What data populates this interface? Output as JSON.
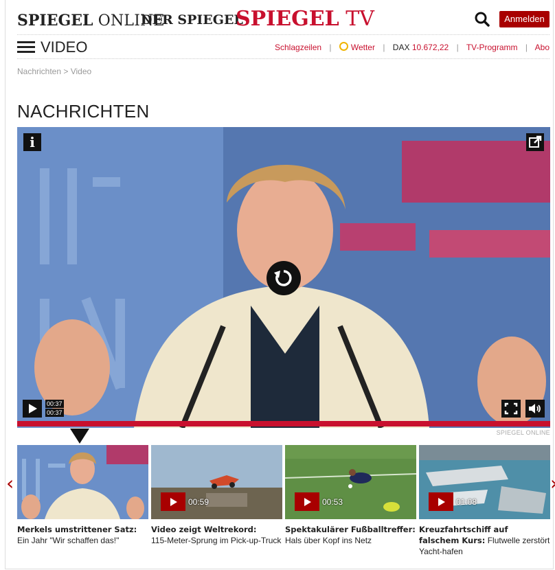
{
  "header": {
    "brand_spiegel_online_bold": "SPIEGEL",
    "brand_spiegel_online_thin": "ONLINE",
    "brand_der_spiegel": "DER SPIEGEL",
    "brand_spiegel_tv_bold": "SPIEGEL",
    "brand_spiegel_tv_thin": "TV",
    "login_label": "Anmelden",
    "search_icon": "search-icon"
  },
  "nav": {
    "menu_icon": "hamburger-menu-icon",
    "section": "VIDEO",
    "links": {
      "schlagzeilen": "Schlagzeilen",
      "wetter": "Wetter",
      "dax_label": "DAX",
      "dax_value": "10.672,22",
      "tv_programm": "TV-Programm",
      "abo": "Abo"
    },
    "separator": "|"
  },
  "breadcrumb": {
    "home": "Nachrichten",
    "sep": " > ",
    "current": "Video"
  },
  "page": {
    "title": "NACHRICHTEN"
  },
  "player": {
    "info_label": "i",
    "elapsed": "00:37",
    "duration": "00:37",
    "progress": 1.0,
    "credit": "SPIEGEL ONLINE",
    "accent_color": "#c8102e"
  },
  "playlist": [
    {
      "title_bold": "Merkels umstrittener Satz:",
      "title_rest": "Ein Jahr \"Wir schaffen das!\"",
      "duration": ""
    },
    {
      "title_bold": "Video zeigt Weltrekord:",
      "title_rest": "115-Meter-Sprung im Pick-up-Truck",
      "duration": "00:59"
    },
    {
      "title_bold": "Spektakulärer Fußballtreffer:",
      "title_rest": "Hals über Kopf ins Netz",
      "duration": "00:53"
    },
    {
      "title_bold": "Kreuzfahrtschiff auf falschem Kurs:",
      "title_rest": "Flutwelle zerstört Yacht-hafen",
      "duration": "01:08"
    }
  ],
  "arrows": {
    "left": "‹",
    "right": "›"
  }
}
